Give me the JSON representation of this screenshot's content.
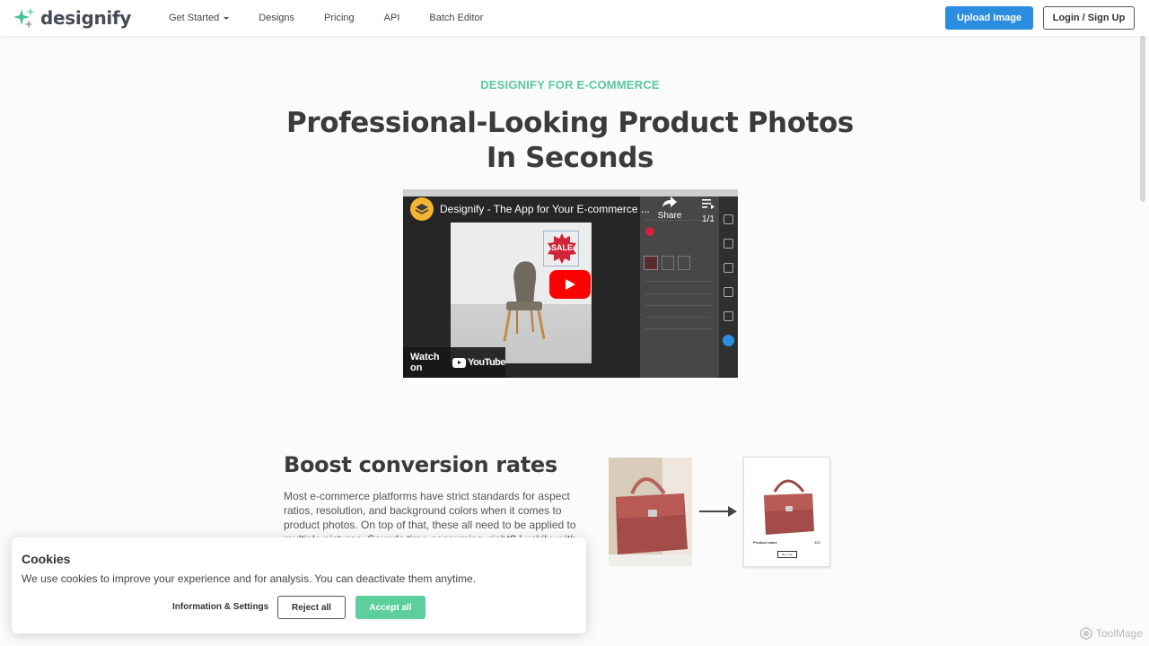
{
  "brand": {
    "name": "designify",
    "accent": "#5cc99c",
    "primary": "#2b8de0",
    "logo_icon": "sparkle-icon"
  },
  "nav": {
    "items": [
      {
        "label": "Get Started",
        "has_dropdown": true
      },
      {
        "label": "Designs"
      },
      {
        "label": "Pricing"
      },
      {
        "label": "API"
      },
      {
        "label": "Batch Editor"
      }
    ],
    "upload_label": "Upload Image",
    "login_label": "Login / Sign Up"
  },
  "hero": {
    "eyebrow": "DESIGNIFY FOR E-COMMERCE",
    "title_line1": "Professional-Looking Product Photos",
    "title_line2": "In Seconds"
  },
  "video": {
    "title": "Designify - The App for Your E-commerce ...",
    "share_label": "Share",
    "queue_label": "1/1",
    "watch_on_label": "Watch on",
    "youtube_label": "YouTube",
    "sale_badge": "SALE"
  },
  "feature": {
    "title": "Boost conversion rates",
    "body": "Most e-commerce platforms have strict standards for aspect ratios, resolution, and background colors when it comes to product photos. On top of that, these all need to be applied to multiple pictures. Sounds time-consuming, right? Luckily, with",
    "card": {
      "product_name": "Product name",
      "price": "$20",
      "button": "Buy now"
    }
  },
  "cookie": {
    "title": "Cookies",
    "text": "We use cookies to improve your experience and for analysis. You can deactivate them anytime.",
    "info_label": "Information & Settings",
    "reject_label": "Reject all",
    "accept_label": "Accept all"
  },
  "watermark": {
    "label": "ToolMage"
  }
}
